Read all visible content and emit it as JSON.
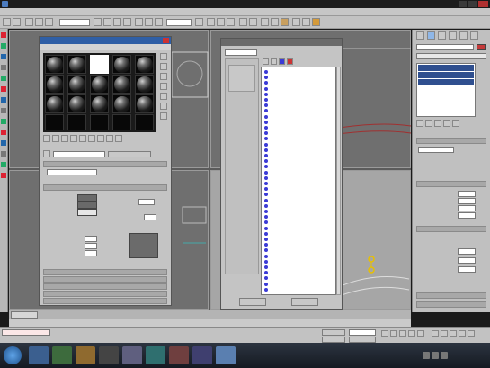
{
  "app": {
    "title": "",
    "title_bar_color": "#1b1b1b"
  },
  "menu": {
    "items": [
      "",
      "",
      "",
      "",
      "",
      "",
      "",
      "",
      "",
      "",
      "",
      "",
      "",
      ""
    ]
  },
  "toolbar": {
    "filter_value": "",
    "view_value": ""
  },
  "material_editor": {
    "title": "",
    "menu_items": [
      "",
      "",
      "",
      ""
    ],
    "left_label": "",
    "right_label": "",
    "material_name": "",
    "type_button": "",
    "rollouts": [
      "",
      "",
      "",
      "",
      "",
      "",
      "",
      ""
    ],
    "shader_value": "",
    "checkboxes": [
      "",
      "",
      "",
      ""
    ],
    "basic_labels": [
      "",
      "",
      ""
    ],
    "self_illum_label": "",
    "color_label": "",
    "opacity_label": "",
    "opacity_value": "",
    "spec_group": "",
    "spec_labels": [
      "",
      "",
      ""
    ],
    "spec_values": [
      "",
      "",
      ""
    ]
  },
  "browser": {
    "title": "",
    "search_value": "",
    "browse_from_label": "",
    "browse_from_options": [
      "",
      "",
      "",
      "",
      "",
      ""
    ],
    "show_label": "",
    "show_options": [
      "",
      "",
      ""
    ],
    "list_items": [
      "",
      "",
      "",
      "",
      "",
      "",
      "",
      "",
      "",
      "",
      "",
      "",
      "",
      "",
      "",
      "",
      "",
      "",
      "",
      "",
      "",
      "",
      "",
      "",
      "",
      "",
      "",
      "",
      "",
      "",
      "",
      "",
      "",
      "",
      "",
      "",
      "",
      "",
      "",
      ""
    ],
    "ok_label": "",
    "cancel_label": ""
  },
  "command_panel": {
    "object_name": "",
    "modifier_list": "",
    "stack_items": [
      "",
      "",
      ""
    ],
    "rollouts": [
      "",
      "",
      "",
      "",
      ""
    ],
    "selection_value": "",
    "check_labels": [
      "",
      ""
    ],
    "field_labels": [
      "",
      "",
      "",
      ""
    ],
    "field_values": [
      "",
      "",
      "",
      ""
    ],
    "soft_labels": [
      "",
      "",
      ""
    ],
    "soft_values": [
      "",
      "",
      ""
    ]
  },
  "status": {
    "frame_range": "",
    "message": "",
    "rendering_time": "",
    "x": "",
    "y": "",
    "z": "",
    "grid": "",
    "auto_key": "",
    "set_key": "",
    "key_filters": "",
    "selected": "",
    "left_input": ""
  },
  "taskbar": {
    "clock": "",
    "date": ""
  },
  "colors": {
    "accent": "#2f5fa6",
    "viewport_bg": "#6f6f6f",
    "selection": "#2f4f8f",
    "wire_red": "#a03030",
    "gizmo_yellow": "#e8c000"
  }
}
